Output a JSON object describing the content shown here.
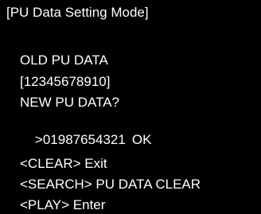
{
  "title": "[PU Data Setting Mode]",
  "old_pu": {
    "label": "OLD PU DATA",
    "value": "[12345678910]"
  },
  "new_pu": {
    "label": "NEW PU DATA?",
    "input": ">01987654321",
    "status": "OK"
  },
  "commands": {
    "clear": "<CLEAR> Exit",
    "search": "<SEARCH> PU DATA CLEAR",
    "play": "<PLAY> Enter"
  },
  "colors": {
    "background": "#000000",
    "text": "#ffffff"
  }
}
